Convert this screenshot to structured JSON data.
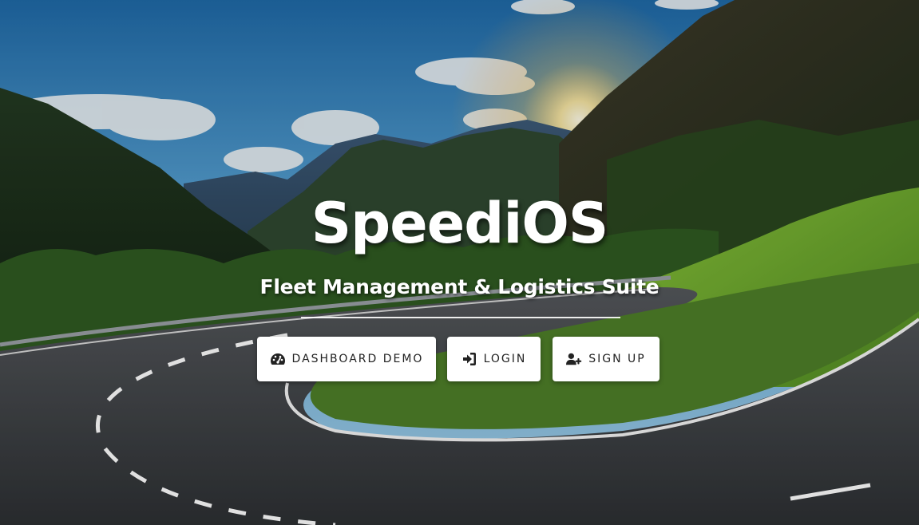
{
  "hero": {
    "background": "mountain road at sunset",
    "title": "SpeediOS",
    "subtitle": "Fleet Management & Logistics Suite"
  },
  "actions": {
    "demo": {
      "label": "Dashboard Demo",
      "icon": "tachometer-icon"
    },
    "login": {
      "label": "Login",
      "icon": "sign-in-icon"
    },
    "signup": {
      "label": "Sign Up",
      "icon": "user-plus-icon"
    }
  },
  "colors": {
    "button_bg": "#ffffff",
    "button_text": "#222222",
    "title_text": "#ffffff"
  }
}
